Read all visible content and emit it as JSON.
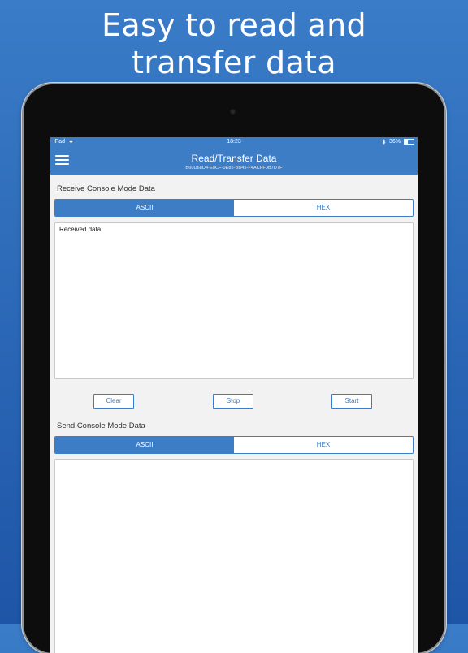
{
  "marketing": {
    "headline_line1": "Easy to read and",
    "headline_line2": "transfer data"
  },
  "statusbar": {
    "device": "iPad",
    "time": "18:23",
    "battery": "36%"
  },
  "navbar": {
    "title": "Read/Transfer Data",
    "device_uuid": "B60D68D4-E8CF-0E85-BB45-F4ACFF0B7D7F"
  },
  "receive": {
    "title": "Receive Console Mode Data",
    "tabs": [
      {
        "label": "ASCII",
        "active": true
      },
      {
        "label": "HEX",
        "active": false
      }
    ],
    "output_placeholder": "Received data",
    "buttons": {
      "clear": "Clear",
      "stop": "Stop",
      "start": "Start"
    }
  },
  "send": {
    "title": "Send Console Mode Data",
    "tabs": [
      {
        "label": "ASCII",
        "active": true
      },
      {
        "label": "HEX",
        "active": false
      }
    ],
    "input_value": ""
  },
  "colors": {
    "accent": "#3d7dc6",
    "background_top": "#3a7cc7",
    "background_bottom": "#1f55a6"
  },
  "icons": {
    "menu": "hamburger-menu-icon",
    "wifi": "wifi-icon",
    "bluetooth": "bluetooth-icon",
    "battery": "battery-icon"
  }
}
